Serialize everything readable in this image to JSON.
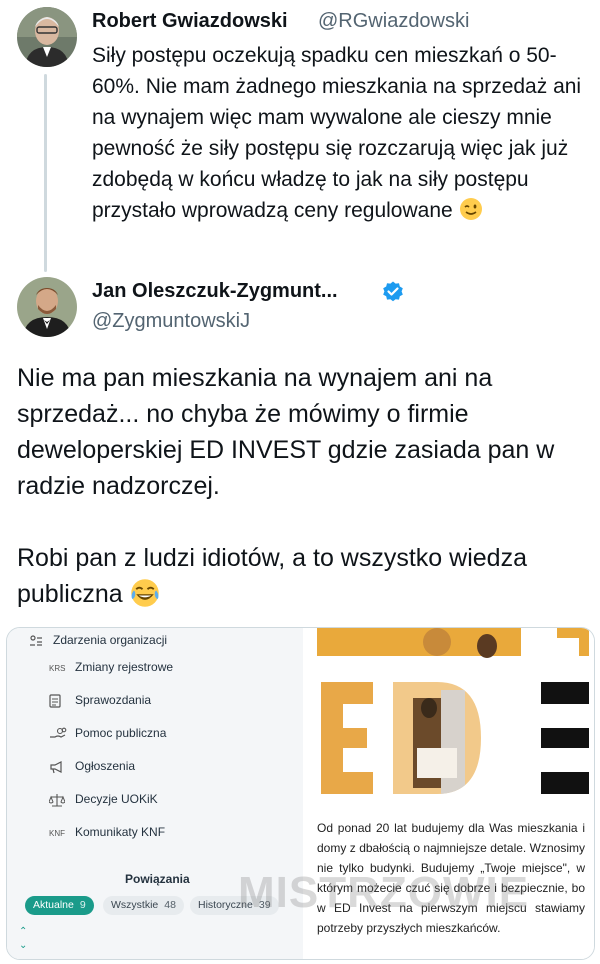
{
  "tweet1": {
    "author_name": "Robert Gwiazdowski",
    "handle": "@RGwiazdowski",
    "text": "Siły postępu oczekują spadku cen mieszkań o 50-60%. Nie mam żadnego mieszkania na sprzedaż ani na wynajem więc mam wywalone ale cieszy mnie pewność że siły postępu się rozczarują więc jak już zdobędą w końcu władzę to jak na siły postępu przystało wprowadzą ceny regulowane",
    "emoji": "winking-face"
  },
  "tweet2": {
    "author_name": "Jan Oleszczuk-Zygmunt...",
    "handle": "@ZygmuntowskiJ",
    "verified": true,
    "paragraph1": "Nie ma pan mieszkania na wynajem ani na sprzedaż... no chyba że mówimy o firmie deweloperskiej ED INVEST gdzie zasiada pan w radzie nadzorczej.",
    "paragraph2": "Robi pan z ludzi idiotów, a to wszystko wiedza publiczna",
    "emoji": "face-with-tears-of-joy"
  },
  "embed": {
    "sidebar": {
      "items": [
        {
          "icon": "org-events-icon",
          "label": "Zdarzenia organizacji"
        },
        {
          "icon": "KRS",
          "label": "Zmiany rejestrowe"
        },
        {
          "icon": "report-icon",
          "label": "Sprawozdania"
        },
        {
          "icon": "hand-coins-icon",
          "label": "Pomoc publiczna"
        },
        {
          "icon": "megaphone-icon",
          "label": "Ogłoszenia"
        },
        {
          "icon": "scales-icon",
          "label": "Decyzje UOKiK"
        },
        {
          "icon": "KNF",
          "label": "Komunikaty KNF"
        }
      ],
      "section_title": "Powiązania",
      "pills": [
        {
          "label": "Aktualne",
          "count": "9"
        },
        {
          "label": "Wszystkie",
          "count": "48"
        },
        {
          "label": "Historyczne",
          "count": "39"
        }
      ]
    },
    "ad": {
      "logo_text": "EDI",
      "text": "Od ponad 20 lat budujemy dla Was mieszkania i domy z dbałością o najmniejsze detale. Wznosimy nie tylko budynki. Budujemy „Twoje miejsce\", w którym możecie czuć się dobrze i bezpiecznie, bo w ED Invest na pierwszym miejscu stawiamy potrzeby przyszłych mieszkańców."
    }
  },
  "watermark": "MISTRZOWIE",
  "colors": {
    "text_primary": "#0f1419",
    "text_secondary": "#536471",
    "verified_blue": "#1d9bf0",
    "accent_teal": "#1a9b8a",
    "photo_gold": "#e9a93b"
  }
}
